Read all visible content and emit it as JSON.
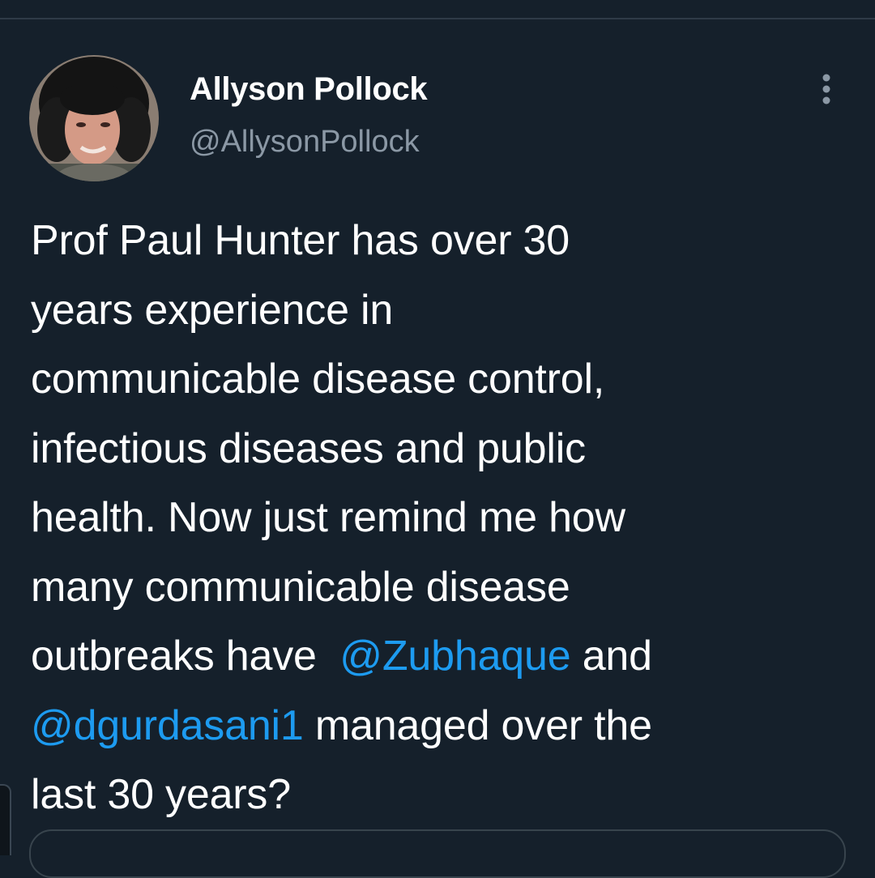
{
  "theme": {
    "background": "#15202b",
    "text_primary": "#ffffff",
    "text_secondary": "#8b98a5",
    "link": "#1d9bf0"
  },
  "tweet": {
    "author": {
      "display_name": "Allyson Pollock",
      "handle": "@AllysonPollock",
      "avatar_icon": "profile-photo"
    },
    "menu_icon": "more-vertical-icon",
    "body_lines": [
      [
        {
          "type": "text",
          "text": "Prof Paul Hunter has over 30"
        }
      ],
      [
        {
          "type": "text",
          "text": "years experience in"
        }
      ],
      [
        {
          "type": "text",
          "text": "communicable disease control,"
        }
      ],
      [
        {
          "type": "text",
          "text": "infectious diseases and public"
        }
      ],
      [
        {
          "type": "text",
          "text": "health. Now just remind me how"
        }
      ],
      [
        {
          "type": "text",
          "text": "many communicable disease"
        }
      ],
      [
        {
          "type": "text",
          "text": "outbreaks have  "
        },
        {
          "type": "mention",
          "text": "@Zubhaque"
        },
        {
          "type": "text",
          "text": " and"
        }
      ],
      [
        {
          "type": "mention",
          "text": "@dgurdasani1"
        },
        {
          "type": "text",
          "text": " managed over the"
        }
      ],
      [
        {
          "type": "text",
          "text": "last 30 years?"
        }
      ]
    ]
  }
}
